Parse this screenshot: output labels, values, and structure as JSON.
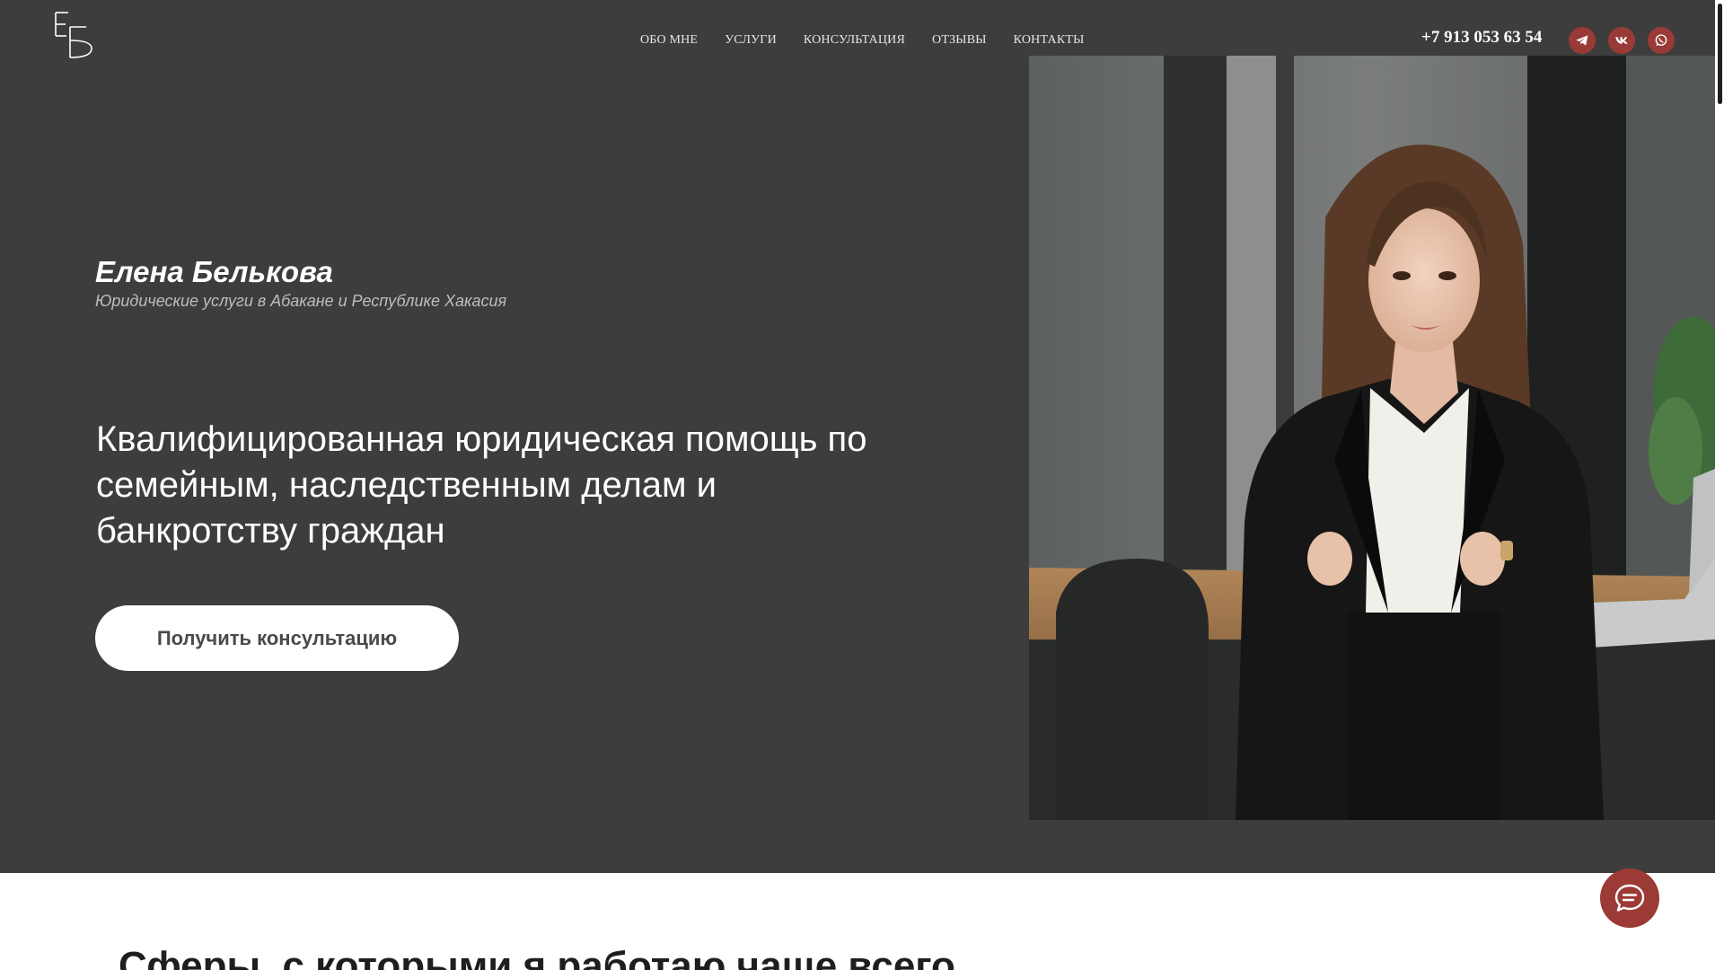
{
  "brand": {
    "logo_letters": "ЕБ"
  },
  "nav": {
    "items": [
      {
        "label": "ОБО МНЕ"
      },
      {
        "label": "УСЛУГИ"
      },
      {
        "label": "КОНСУЛЬТАЦИЯ"
      },
      {
        "label": "ОТЗЫВЫ"
      },
      {
        "label": "КОНТАКТЫ"
      }
    ]
  },
  "contact": {
    "phone": "+7 913 053 63 54",
    "socials": [
      {
        "icon": "telegram-icon"
      },
      {
        "icon": "vk-icon"
      },
      {
        "icon": "whatsapp-icon"
      }
    ]
  },
  "hero": {
    "name": "Елена Белькова",
    "tagline": "Юридические услуги в Абакане и Республике Хакасия",
    "headline": "Квалифицированная юридическая помощь по семейным, наследственным делам и банкротству граждан",
    "cta_label": "Получить консультацию"
  },
  "next_section": {
    "title": "Сферы, с которыми я работаю чаще всего"
  },
  "colors": {
    "hero_bg": "#3d3d3d",
    "accent": "#9c3a36",
    "button_bg": "#ffffff",
    "button_text": "#4a4a4a"
  },
  "icons": {
    "chat": "chat-bubble-icon"
  }
}
